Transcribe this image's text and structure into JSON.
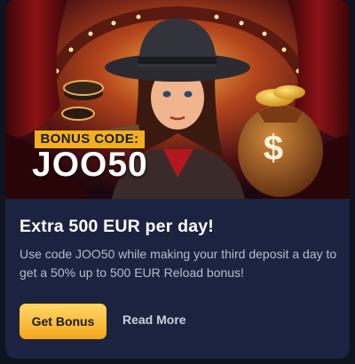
{
  "promo": {
    "bonus_label": "BONUS CODE:",
    "code": "JOO50",
    "title": "Extra 500 EUR per day!",
    "description": "Use code JOO50 while making your third deposit a day to get a 50% up to 500 EUR Reload bonus!",
    "primary_button": "Get Bonus",
    "secondary_link": "Read More"
  },
  "colors": {
    "card_bg": "#1c2340",
    "accent": "#f4a81d",
    "badge": "#f2b01e",
    "text_muted": "#b6bbd0"
  }
}
